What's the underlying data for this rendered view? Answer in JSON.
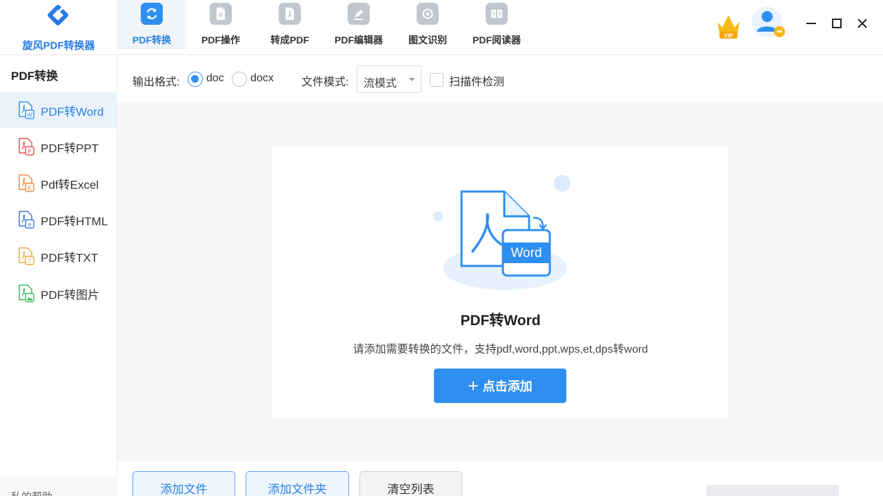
{
  "app": {
    "logo_text": "旋风PDF转换器"
  },
  "nav": {
    "items": [
      {
        "label": "PDF转换",
        "icon": "convert-icon",
        "active": true
      },
      {
        "label": "PDF操作",
        "icon": "document-icon",
        "active": false
      },
      {
        "label": "转成PDF",
        "icon": "pdf-file-icon",
        "active": false
      },
      {
        "label": "PDF编辑器",
        "icon": "edit-icon",
        "active": false
      },
      {
        "label": "图文识别",
        "icon": "ocr-icon",
        "active": false
      },
      {
        "label": "PDF阅读器",
        "icon": "reader-icon",
        "active": false
      }
    ]
  },
  "window": {
    "vip_icon": "vip-crown-icon",
    "avatar_icon": "user-avatar-icon",
    "minimize": "minimize-icon",
    "maximize": "maximize-icon",
    "close": "close-icon"
  },
  "sidebar": {
    "title": "PDF转换",
    "items": [
      {
        "label": "PDF转Word",
        "icon": "pdf-word-icon",
        "badge": "W",
        "color": "#2f8ff0",
        "active": true
      },
      {
        "label": "PDF转PPT",
        "icon": "pdf-ppt-icon",
        "badge": "P",
        "color": "#e8544f",
        "active": false
      },
      {
        "label": "Pdf转Excel",
        "icon": "pdf-excel-icon",
        "badge": "E",
        "color": "#f08a3c",
        "active": false
      },
      {
        "label": "PDF转HTML",
        "icon": "pdf-html-icon",
        "badge": "e",
        "color": "#3f74e0",
        "active": false
      },
      {
        "label": "PDF转TXT",
        "icon": "pdf-txt-icon",
        "badge": "T",
        "color": "#f2a93b",
        "active": false
      },
      {
        "label": "PDF转图片",
        "icon": "pdf-image-icon",
        "badge": "▲",
        "color": "#3cb95a",
        "active": false
      }
    ],
    "footer": "私的帮助"
  },
  "options": {
    "output_format_label": "输出格式:",
    "formats": [
      {
        "label": "doc",
        "checked": true
      },
      {
        "label": "docx",
        "checked": false
      }
    ],
    "file_mode_label": "文件模式:",
    "file_mode_value": "流模式",
    "scan_check_label": "扫描件检测",
    "scan_check_checked": false
  },
  "card": {
    "illustration_badge": "Word",
    "title": "PDF转Word",
    "description": "请添加需要转换的文件，支持pdf,word,ppt,wps,et,dps转word",
    "add_button": "点击添加"
  },
  "bottom": {
    "add_file": "添加文件",
    "add_folder": "添加文件夹",
    "clear_list": "清空列表"
  },
  "colors": {
    "accent": "#2f8ff0",
    "accent_text": "#2a82e4",
    "sidebar_active_bg": "#eaf2fc",
    "main_bg": "#f5f6f8"
  }
}
